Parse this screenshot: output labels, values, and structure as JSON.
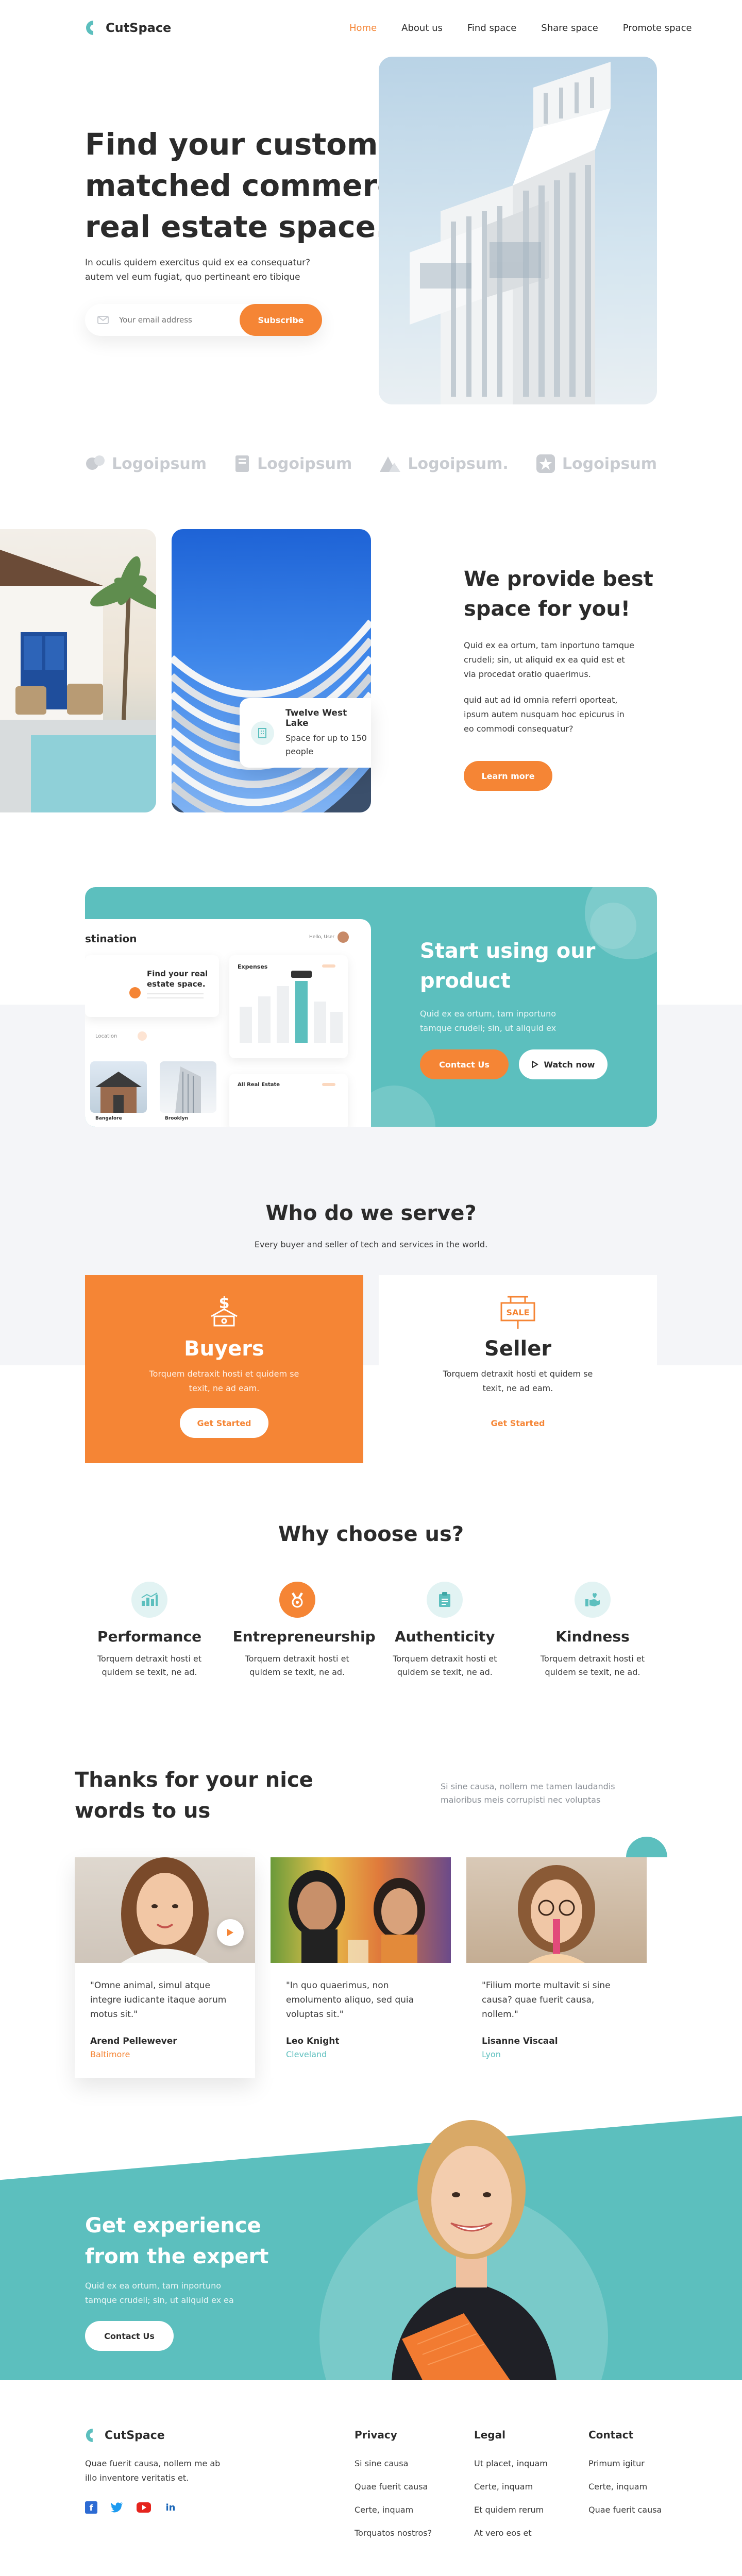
{
  "brand": {
    "name": "CutSpace",
    "accent": "#f58535",
    "teal": "#5cbfbe"
  },
  "nav": {
    "items": [
      {
        "label": "Home",
        "active": true
      },
      {
        "label": "About us",
        "active": false
      },
      {
        "label": "Find space",
        "active": false
      },
      {
        "label": "Share space",
        "active": false
      },
      {
        "label": "Promote space",
        "active": false
      }
    ]
  },
  "hero": {
    "title_line1": "Find your custom",
    "title_line2": "matched commercial",
    "title_line3": "real estate space.",
    "subtitle_line1": "In oculis quidem exercitus quid ex ea consequatur?",
    "subtitle_line2": "autem vel eum fugiat, quo pertineant ero tibique",
    "email_placeholder": "Your email address",
    "subscribe_label": "Subscribe"
  },
  "logos": [
    "Logoipsum",
    "Logoipsum",
    "Logoipsum.",
    "Logoipsum"
  ],
  "provide": {
    "title_line1": "We provide best",
    "title_line2": "space for you!",
    "para1_line1": "Quid ex ea ortum, tam inportuno tamque",
    "para1_line2": "crudeli; sin, ut aliquid ex ea quid est et",
    "para1_line3": "via procedat oratio quaerimus.",
    "para2_line1": "quid aut ad id omnia referri oporteat,",
    "para2_line2": "ipsum autem nusquam hoc epicurus in",
    "para2_line3": "eo commodi consequatur?",
    "learn_label": "Learn more",
    "badge_title": "Twelve West Lake",
    "badge_line1": "Space for up to 150",
    "badge_line2": "people"
  },
  "product": {
    "title_line1": "Start using our",
    "title_line2": "product",
    "desc_line1": "Quid ex ea ortum, tam inportuno",
    "desc_line2": "tamque crudeli; sin, ut aliquid ex",
    "contact_label": "Contact Us",
    "watch_label": "Watch now",
    "mock": {
      "heading": "stination",
      "hello": "Hello, User",
      "find_line1": "Find your real",
      "find_line2": "estate space.",
      "expenses": "Expenses",
      "location": "Location",
      "card1": "Bangalore",
      "card2": "Brooklyn",
      "all": "All Real Estate"
    }
  },
  "serve": {
    "title": "Who do we serve?",
    "subtitle": "Every buyer and seller of tech and services in the world.",
    "buyers": {
      "title": "Buyers",
      "line1": "Torquem detraxit hosti et quidem se",
      "line2": "texit, ne ad eam.",
      "cta": "Get Started"
    },
    "seller": {
      "title": "Seller",
      "sale": "SALE",
      "line1": "Torquem detraxit hosti et quidem se",
      "line2": "texit, ne ad eam.",
      "cta": "Get Started"
    }
  },
  "why": {
    "title": "Why choose us?",
    "items": [
      {
        "title": "Performance",
        "line1": "Torquem detraxit hosti et",
        "line2": "quidem se texit, ne ad.",
        "icon": "bar-chart-icon"
      },
      {
        "title": "Entrepreneurship",
        "line1": "Torquem detraxit hosti et",
        "line2": "quidem se texit, ne ad.",
        "icon": "medal-icon"
      },
      {
        "title": "Authenticity",
        "line1": "Torquem detraxit hosti et",
        "line2": "quidem se texit, ne ad.",
        "icon": "clipboard-icon"
      },
      {
        "title": "Kindness",
        "line1": "Torquem detraxit hosti et",
        "line2": "quidem se texit, ne ad.",
        "icon": "hand-heart-icon"
      }
    ]
  },
  "testimonials": {
    "title_line1": "Thanks for your nice",
    "title_line2": "words to us",
    "side_line1": "Si sine causa, nollem me tamen laudandis",
    "side_line2": "maioribus meis corrupisti nec voluptas",
    "items": [
      {
        "q1": "\"Omne animal, simul atque",
        "q2": "integre iudicante itaque aorum",
        "q3": "motus sit.\"",
        "name": "Arend Pellewever",
        "city": "Baltimore",
        "city_color": "#f58535"
      },
      {
        "q1": "\"In quo quaerimus, non",
        "q2": "emolumento aliquo, sed quia",
        "q3": "voluptas sit.\"",
        "name": "Leo Knight",
        "city": "Cleveland",
        "city_color": "#5cbfbe"
      },
      {
        "q1": "\"Filium morte multavit si sine",
        "q2": "causa? quae fuerit causa,",
        "q3": "nollem.\"",
        "name": "Lisanne Viscaal",
        "city": "Lyon",
        "city_color": "#5cbfbe"
      }
    ]
  },
  "expert": {
    "title_line1": "Get experience",
    "title_line2": "from the expert",
    "desc_line1": "Quid ex ea ortum, tam inportuno",
    "desc_line2": "tamque crudeli; sin, ut aliquid ex ea",
    "contact_label": "Contact Us"
  },
  "footer": {
    "brand": "CutSpace",
    "about_line1": "Quae fuerit causa, nollem me ab",
    "about_line2": "illo inventore veritatis et.",
    "columns": [
      {
        "title": "Privacy",
        "links": [
          "Si sine causa",
          "Quae fuerit causa",
          "Certe, inquam",
          "Torquatos nostros?"
        ]
      },
      {
        "title": "Legal",
        "links": [
          "Ut placet, inquam",
          "Certe, inquam",
          "Et quidem rerum",
          "At vero eos et"
        ]
      },
      {
        "title": "Contact",
        "links": [
          "Primum igitur",
          "Certe, inquam",
          "Quae fuerit causa"
        ]
      }
    ]
  }
}
